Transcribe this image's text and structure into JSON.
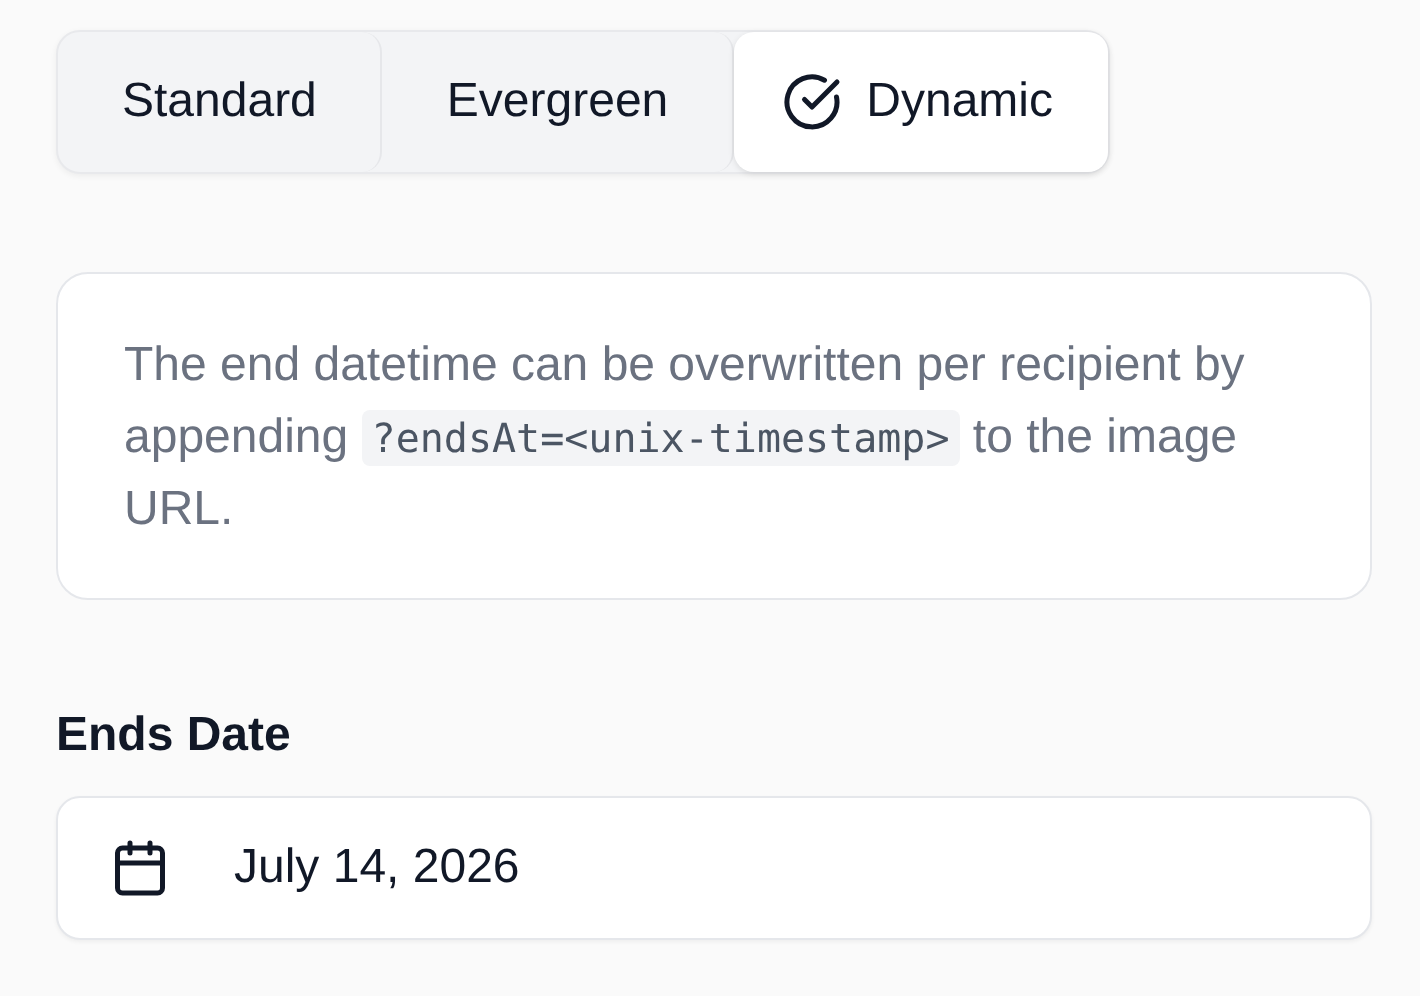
{
  "tabs": [
    {
      "label": "Standard",
      "selected": false
    },
    {
      "label": "Evergreen",
      "selected": false
    },
    {
      "label": "Dynamic",
      "selected": true
    }
  ],
  "info": [
    {
      "kind": "text",
      "text": "The end datetime can be overwritten per recipient by appending "
    },
    {
      "kind": "code",
      "text": "?endsAt=<unix-timestamp>"
    },
    {
      "kind": "text",
      "text": " to the image URL."
    }
  ],
  "ends_date": {
    "label": "Ends Date",
    "value": "July 14, 2026"
  }
}
